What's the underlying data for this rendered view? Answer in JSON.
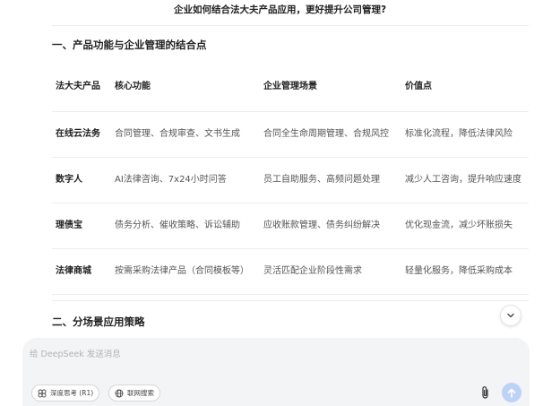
{
  "question": "企业如何结合法大夫产品应用，更好提升公司管理?",
  "section1": {
    "title": "一、产品功能与企业管理的结合点",
    "headers": [
      "法大夫产品",
      "核心功能",
      "企业管理场景",
      "价值点"
    ],
    "rows": [
      [
        "在线云法务",
        "合同管理、合规审查、文书生成",
        "合同全生命周期管理、合规风控",
        "标准化流程，降低法律风险"
      ],
      [
        "数字人",
        "AI法律咨询、7x24小时问答",
        "员工自助服务、高频问题处理",
        "减少人工咨询，提升响应速度"
      ],
      [
        "理债宝",
        "债务分析、催收策略、诉讼辅助",
        "应收账款管理、债务纠纷解决",
        "优化现金流，减少坏账损失"
      ],
      [
        "法律商城",
        "按需采购法律产品（合同模板等）",
        "灵活匹配企业阶段性需求",
        "轻量化服务，降低采购成本"
      ]
    ]
  },
  "section2": {
    "title": "二、分场景应用策略"
  },
  "composer": {
    "placeholder": "给 DeepSeek 发送消息",
    "deep_think_label": "深度思考 (R1)",
    "web_search_label": "联网搜索"
  },
  "colors": {
    "send_button": "#bcd2f7",
    "composer_bg": "#f3f4f6"
  },
  "icons": [
    "chevron-down-icon",
    "deep-think-icon",
    "globe-icon",
    "paperclip-icon",
    "arrow-up-icon"
  ]
}
